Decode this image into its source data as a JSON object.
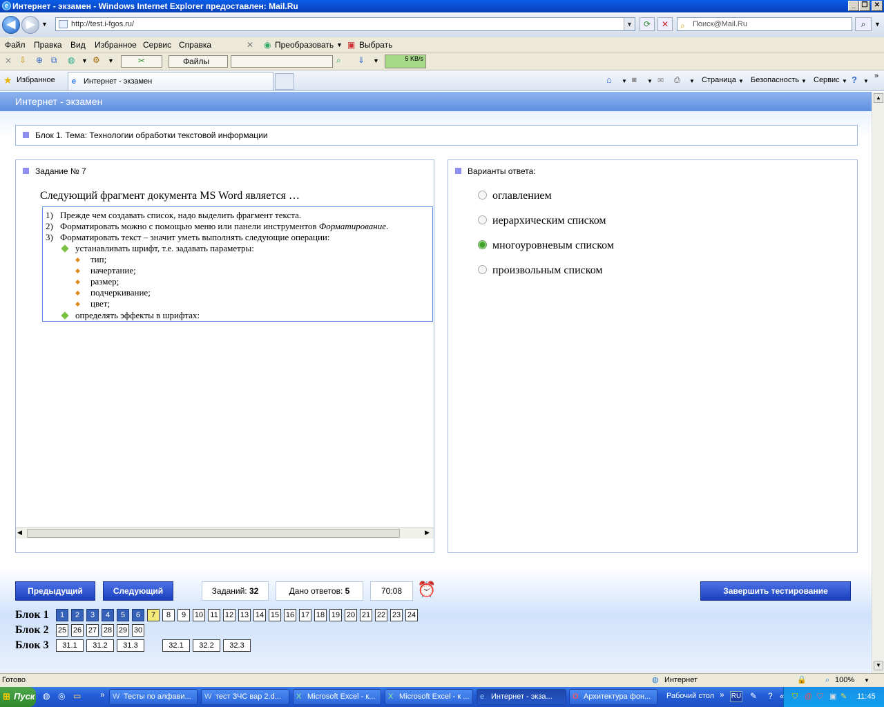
{
  "window": {
    "title": "Интернет - экзамен - Windows Internet Explorer предоставлен: Mail.Ru"
  },
  "address": {
    "url": "http://test.i-fgos.ru/",
    "search_placeholder": "Поиск@Mail.Ru"
  },
  "menu": {
    "items": [
      "Файл",
      "Правка",
      "Вид",
      "Избранное",
      "Сервис",
      "Справка"
    ],
    "convert": "Преобразовать",
    "select": "Выбрать"
  },
  "toolbar": {
    "files_label": "Файлы",
    "speed": "5 KB/s"
  },
  "favorites": {
    "label": "Избранное",
    "tab_title": "Интернет - экзамен",
    "page_menu": "Страница",
    "safety_menu": "Безопасность",
    "service_menu": "Сервис"
  },
  "page": {
    "header": "Интернет - экзамен",
    "block_title": "Блок 1. Тема: Технологии обработки текстовой информации",
    "task_label": "Задание № 7",
    "question": "Следующий фрагмент документа MS Word является …",
    "fragment": {
      "line1_num": "1)",
      "line1": "Прежде чем создавать список, надо выделить фрагмент текста.",
      "line2_num": "2)",
      "line2": "Форматировать можно с помощью меню или панели инструментов ",
      "line2_em": "Форматирование",
      "line3_num": "3)",
      "line3": "Форматировать текст – значит  уметь выполнять следующие операции:",
      "sub1": "устанавливать шрифт, т.е. задавать параметры:",
      "subsub": [
        "тип;",
        "начертание;",
        "размер;",
        "подчеркивание;",
        "цвет;"
      ],
      "sub2": "определять эффекты в шрифтах:"
    },
    "answers_label": "Варианты ответа:",
    "options": [
      "оглавлением",
      "иерархическим списком",
      "многоуровневым списком",
      "произвольным списком"
    ],
    "selected_option": 2
  },
  "nav": {
    "prev": "Предыдущий",
    "next": "Следующий",
    "tasks_label": "Заданий:",
    "tasks_count": "32",
    "answered_label": "Дано ответов:",
    "answered_count": "5",
    "timer": "70:08",
    "finish": "Завершить тестирование",
    "block1_label": "Блок 1",
    "block2_label": "Блок 2",
    "block3_label": "Блок 3",
    "block1": [
      "1",
      "2",
      "3",
      "4",
      "5",
      "6",
      "7",
      "8",
      "9",
      "10",
      "11",
      "12",
      "13",
      "14",
      "15",
      "16",
      "17",
      "18",
      "19",
      "20",
      "21",
      "22",
      "23",
      "24"
    ],
    "block1_done": [
      "1",
      "2",
      "3",
      "4",
      "5",
      "6"
    ],
    "current": "7",
    "block2": [
      "25",
      "26",
      "27",
      "28",
      "29",
      "30"
    ],
    "block3": [
      "31.1",
      "31.2",
      "31.3",
      "32.1",
      "32.2",
      "32.3"
    ]
  },
  "status": {
    "text": "Готово",
    "zone": "Интернет",
    "zoom": "100%"
  },
  "taskbar": {
    "start": "Пуск",
    "items": [
      "Тесты по алфави...",
      "тест ЗЧС вар 2.d...",
      "Microsoft Excel - к...",
      "Microsoft Excel - к ...",
      "Интернет - экза...",
      "Архитектура фон..."
    ],
    "desktop": "Рабочий стол",
    "lang": "RU",
    "clock": "11:45"
  },
  "colors": {
    "accent": "#5e8fe0",
    "button": "#1b3fbf",
    "done": "#3561b8",
    "current": "#f5e97a",
    "selected_radio": "#3fa12b"
  }
}
